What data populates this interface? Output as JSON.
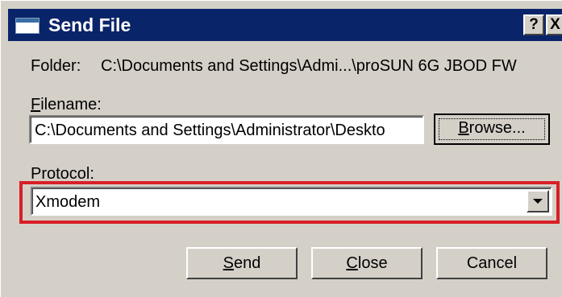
{
  "window": {
    "title": "Send File",
    "help_glyph": "?",
    "close_glyph": "X"
  },
  "folder": {
    "label": "Folder:",
    "value": "C:\\Documents and Settings\\Admi...\\proSUN 6G JBOD FW"
  },
  "filename": {
    "label_mnemonic": "F",
    "label_rest": "ilename:",
    "value": "C:\\Documents and Settings\\Administrator\\Deskto"
  },
  "browse": {
    "mnemonic": "B",
    "rest": "rowse..."
  },
  "protocol": {
    "label": "Protocol:",
    "selected": "Xmodem",
    "highlight_color": "#d81f26"
  },
  "buttons": {
    "send_mnemonic": "S",
    "send_rest": "end",
    "close_mnemonic": "C",
    "close_rest": "lose",
    "cancel": "Cancel"
  },
  "colors": {
    "titlebar": "#0a246a",
    "face": "#d4d0c8"
  }
}
